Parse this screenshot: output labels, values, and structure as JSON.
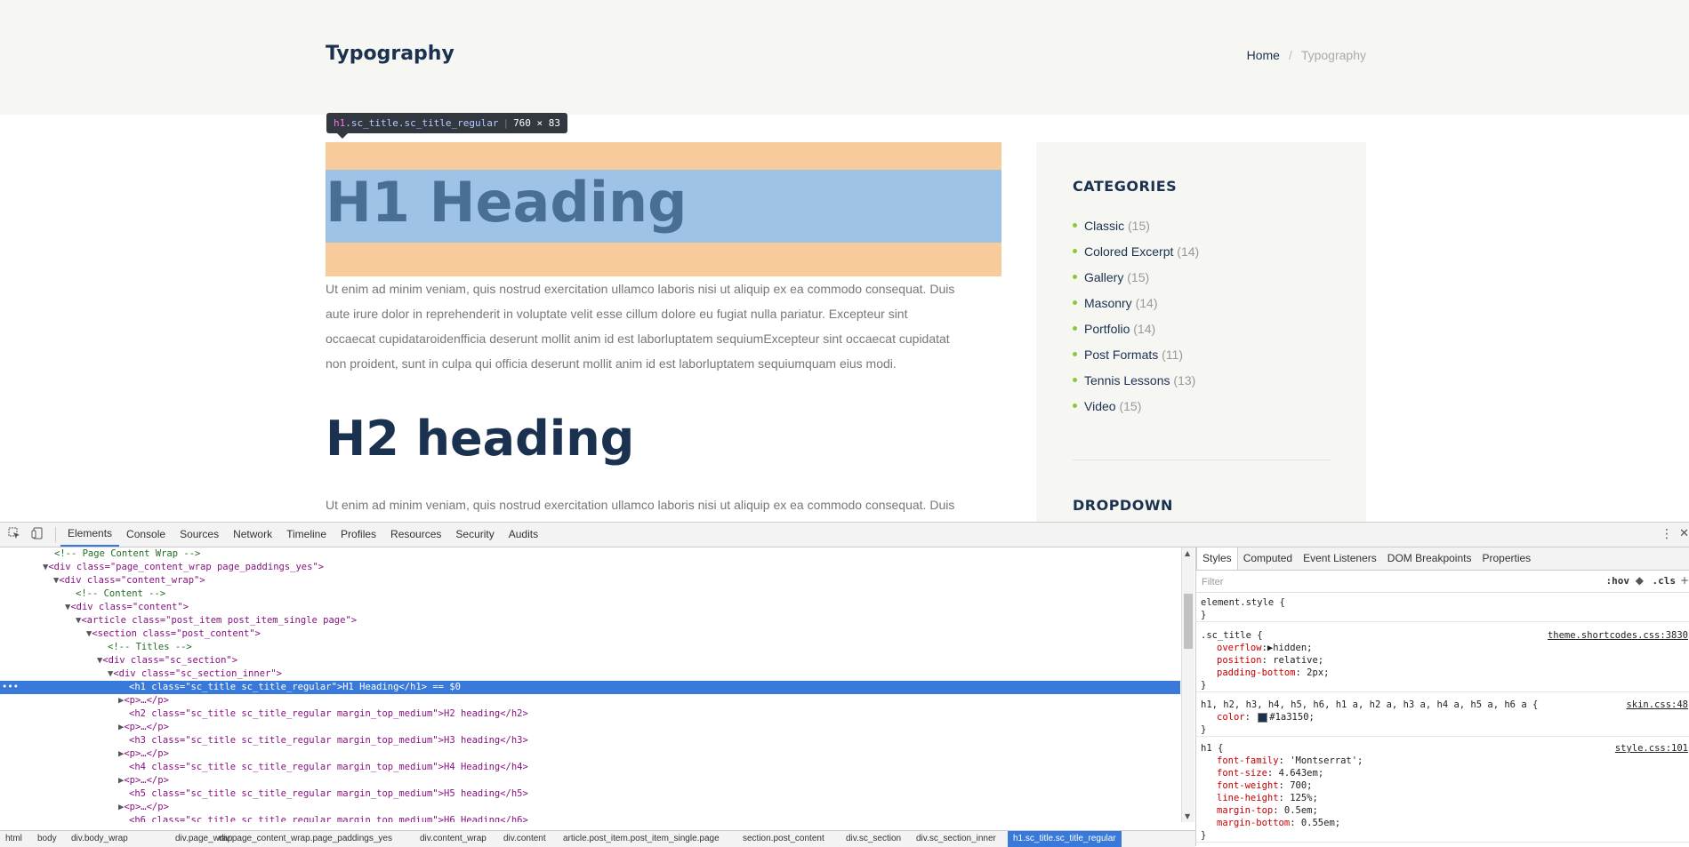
{
  "page": {
    "title": "Typography",
    "breadcrumbs": {
      "home": "Home",
      "separator": "/",
      "current": "Typography"
    },
    "h1": "H1 Heading",
    "h2": "H2 heading",
    "paragraph_1_lines": [
      "Ut enim ad minim veniam, quis nostrud exercitation ullamco laboris nisi ut aliquip ex ea commodo consequat. Duis",
      "aute irure dolor in reprehenderit in voluptate velit esse cillum dolore eu fugiat nulla pariatur. Excepteur sint",
      "occaecat cupidataroidenfficia deserunt mollit anim id est laborluptatem sequiumExcepteur sint occaecat cupidatat",
      "non proident, sunt in culpa qui officia deserunt mollit anim id est laborluptatem sequiumquam eius modi."
    ],
    "paragraph_2": "Ut enim ad minim veniam, quis nostrud exercitation ullamco laboris nisi ut aliquip ex ea commodo consequat. Duis"
  },
  "tooltip": {
    "tag": "h1",
    "classes": ".sc_title.sc_title_regular",
    "size": "760 × 83"
  },
  "sidebar": {
    "categories_title": "CATEGORIES",
    "categories": [
      {
        "name": "Classic",
        "count": "(15)"
      },
      {
        "name": "Colored Excerpt",
        "count": "(14)"
      },
      {
        "name": "Gallery",
        "count": "(15)"
      },
      {
        "name": "Masonry",
        "count": "(14)"
      },
      {
        "name": "Portfolio",
        "count": "(14)"
      },
      {
        "name": "Post Formats",
        "count": "(11)"
      },
      {
        "name": "Tennis Lessons",
        "count": "(13)"
      },
      {
        "name": "Video",
        "count": "(15)"
      }
    ],
    "dropdown_title": "DROPDOWN"
  },
  "devtools": {
    "tabs": [
      "Elements",
      "Console",
      "Sources",
      "Network",
      "Timeline",
      "Profiles",
      "Resources",
      "Security",
      "Audits"
    ],
    "active_tab": "Elements",
    "dom_lines": [
      "<!-- Page Content Wrap -->",
      "<div class=\"page_content_wrap page_paddings_yes\">",
      "<div class=\"content_wrap\">",
      "<!-- Content -->",
      "<div class=\"content\">",
      "<article class=\"post_item post_item_single page\">",
      "<section class=\"post_content\">",
      "<!-- Titles -->",
      "<div class=\"sc_section\">",
      "<div class=\"sc_section_inner\">",
      "<h1 class=\"sc_title sc_title_regular\">H1 Heading</h1> == $0",
      "<p>…</p>",
      "<h2 class=\"sc_title sc_title_regular margin_top_medium\">H2 heading</h2>",
      "<p>…</p>",
      "<h3 class=\"sc_title sc_title_regular margin_top_medium\">H3 heading</h3>",
      "<p>…</p>",
      "<h4 class=\"sc_title sc_title_regular margin_top_medium\">H4 Heading</h4>",
      "<p>…</p>",
      "<h5 class=\"sc_title sc_title_regular margin_top_medium\">H5 heading</h5>",
      "<p>…</p>",
      "<h6 class=\"sc_title sc_title_regular margin_top_medium\">H6 Heading</h6>"
    ],
    "breadcrumbs": [
      "html",
      "body",
      "div.body_wrap",
      "div.page_wrap",
      "div.page_content_wrap.page_paddings_yes",
      "div.content_wrap",
      "div.content",
      "article.post_item.post_item_single.page",
      "section.post_content",
      "div.sc_section",
      "div.sc_section_inner",
      "h1.sc_title.sc_title_regular"
    ],
    "styles_tabs": [
      "Styles",
      "Computed",
      "Event Listeners",
      "DOM Breakpoints",
      "Properties"
    ],
    "filter_placeholder": "Filter",
    "hov": ":hov",
    "cls": ".cls",
    "rules": {
      "element_style": {
        "selector": "element.style {",
        "close": "}"
      },
      "sc_title": {
        "selector": ".sc_title {",
        "source": "theme.shortcodes.css:3830",
        "props": [
          {
            "name": "overflow",
            "value": "hidden;"
          },
          {
            "name": "position",
            "value": "relative;"
          },
          {
            "name": "padding-bottom",
            "value": "2px;"
          }
        ],
        "close": "}"
      },
      "headings": {
        "selector": "h1, h2, h3, h4, h5, h6, h1 a, h2 a, h3 a, h4 a, h5 a, h6 a {",
        "source": "skin.css:48",
        "props": [
          {
            "name": "color",
            "value": "#1a3150;"
          }
        ],
        "close": "}"
      },
      "h1": {
        "selector": "h1 {",
        "source": "style.css:101",
        "props": [
          {
            "name": "font-family",
            "value": "'Montserrat';"
          },
          {
            "name": "font-size",
            "value": "4.643em;"
          },
          {
            "name": "font-weight",
            "value": "700;"
          },
          {
            "name": "line-height",
            "value": "125%;"
          },
          {
            "name": "margin-top",
            "value": "0.5em;"
          },
          {
            "name": "margin-bottom",
            "value": "0.55em;"
          }
        ],
        "close": "}"
      }
    }
  },
  "colors": {
    "heading": "#1a3150",
    "text": "#777777",
    "margin_overlay": "#f8cb9c",
    "content_overlay": "#9fc3e7",
    "selection": "#3879d9",
    "bullet": "#8dc63f"
  }
}
